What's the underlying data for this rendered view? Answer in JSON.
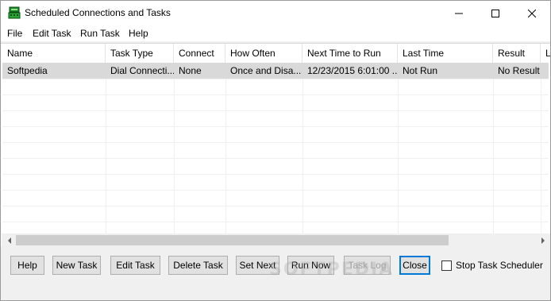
{
  "window": {
    "title": "Scheduled Connections and Tasks",
    "icon": "phone-modem-icon"
  },
  "menu": {
    "items": [
      "File",
      "Edit Task",
      "Run Task",
      "Help"
    ]
  },
  "table": {
    "columns": [
      "Name",
      "Task Type",
      "Connect",
      "How Often",
      "Next Time to Run",
      "Last Time",
      "Result",
      "L"
    ],
    "rows": [
      {
        "selected": true,
        "cells": [
          "Softpedia",
          "Dial Connecti...",
          "None",
          "Once and Disa...",
          "12/23/2015 6:01:00 ...",
          "Not Run",
          "No Result",
          ""
        ]
      }
    ]
  },
  "buttons": {
    "help": "Help",
    "new_task": "New Task",
    "edit_task": "Edit Task",
    "delete_task": "Delete Task",
    "set_next": "Set Next",
    "run_now": "Run Now",
    "task_log": "Task Log",
    "close": "Close"
  },
  "options": {
    "stop_scheduler_label": "Stop Task Scheduler",
    "stop_scheduler_checked": false
  },
  "watermark": "SOFTPEDIA",
  "colors": {
    "selected_row": "#d9d9d9",
    "default_button_border": "#0078d7"
  }
}
